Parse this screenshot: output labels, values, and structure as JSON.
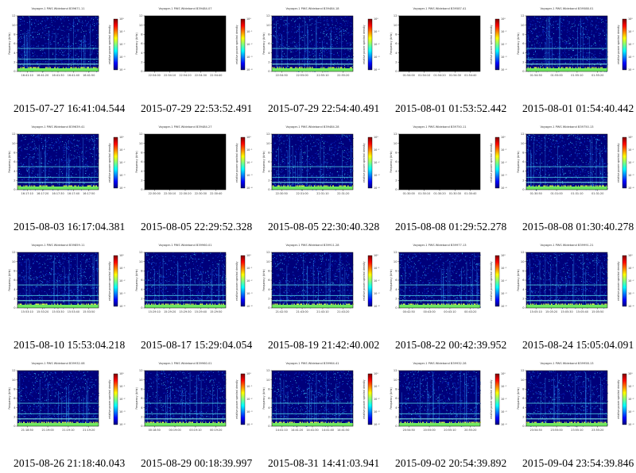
{
  "chart_data": {
    "type": "heatmap",
    "layout": {
      "rows": 4,
      "cols": 5
    },
    "panel_title_prefix": "Voyager-1 PWS Wideband",
    "ylabel": "Frequency (kHz)",
    "colorbar_label": "relative power spectral density",
    "y_ticks": [
      "0",
      "2",
      "4",
      "6",
      "8",
      "10",
      "12"
    ],
    "ylim": [
      0,
      12
    ],
    "colorbar_ticks": [
      "10⁻⁴",
      "10⁻³",
      "10⁻²",
      "10⁻¹",
      "10⁰"
    ],
    "colormap": [
      "#00007f",
      "#0000ff",
      "#007fff",
      "#00ffff",
      "#7fff7f",
      "#ffff00",
      "#ff7f00",
      "#ff0000",
      "#7f0000"
    ],
    "panels": [
      {
        "caption": "2015-07-27 16:41:04.544",
        "id": "B39671.11",
        "has_data": true,
        "x_ticks": [
          "16:41:10",
          "16:41:20",
          "16:41:30",
          "16:41:40",
          "16:41:50"
        ]
      },
      {
        "caption": "2015-07-29 22:53:52.491",
        "id": "B39484.07",
        "has_data": false,
        "x_ticks": [
          "22:54:00",
          "22:54:10",
          "22:54:20",
          "22:54:30",
          "22:54:40"
        ]
      },
      {
        "caption": "2015-07-29 22:54:40.491",
        "id": "B39484.18",
        "has_data": true,
        "x_ticks": [
          "22:54:50",
          "22:55:00",
          "22:55:10",
          "22:55:20"
        ]
      },
      {
        "caption": "2015-08-01 01:53:52.442",
        "id": "B39587.41",
        "has_data": false,
        "x_ticks": [
          "01:54:00",
          "01:54:10",
          "01:54:20",
          "01:54:30",
          "01:54:40"
        ]
      },
      {
        "caption": "2015-08-01 01:54:40.442",
        "id": "B39588.01",
        "has_data": true,
        "x_ticks": [
          "01:54:50",
          "01:55:00",
          "01:55:10",
          "01:55:20"
        ]
      },
      {
        "caption": "2015-08-03 16:17:04.381",
        "id": "B39639.41",
        "has_data": true,
        "x_ticks": [
          "16:17:10",
          "16:17:20",
          "16:17:30",
          "16:17:40",
          "16:17:50"
        ]
      },
      {
        "caption": "2015-08-05 22:29:52.328",
        "id": "B39484.27",
        "has_data": false,
        "x_ticks": [
          "22:30:00",
          "22:30:10",
          "22:30:20",
          "22:30:30",
          "22:30:40"
        ]
      },
      {
        "caption": "2015-08-05 22:30:40.328",
        "id": "B39484.28",
        "has_data": true,
        "x_ticks": [
          "22:30:50",
          "22:31:00",
          "22:31:10",
          "22:31:20"
        ]
      },
      {
        "caption": "2015-08-08 01:29:52.278",
        "id": "B39750.11",
        "has_data": false,
        "x_ticks": [
          "01:30:00",
          "01:30:10",
          "01:30:20",
          "01:30:30",
          "01:30:40"
        ]
      },
      {
        "caption": "2015-08-08 01:30:40.278",
        "id": "B39750.13",
        "has_data": true,
        "x_ticks": [
          "01:30:50",
          "01:31:00",
          "01:31:10",
          "01:31:20"
        ]
      },
      {
        "caption": "2015-08-10 15:53:04.218",
        "id": "B39859.11",
        "has_data": true,
        "x_ticks": [
          "15:53:10",
          "15:53:20",
          "15:53:30",
          "15:53:40",
          "15:53:50"
        ]
      },
      {
        "caption": "2015-08-17 15:29:04.054",
        "id": "B39960.01",
        "has_data": true,
        "x_ticks": [
          "15:29:10",
          "15:29:20",
          "15:29:30",
          "15:29:40",
          "15:29:50"
        ]
      },
      {
        "caption": "2015-08-19 21:42:40.002",
        "id": "B39911.28",
        "has_data": true,
        "x_ticks": [
          "21:42:50",
          "21:43:00",
          "21:43:10",
          "21:43:20"
        ]
      },
      {
        "caption": "2015-08-22 00:42:39.952",
        "id": "B39977.13",
        "has_data": true,
        "x_ticks": [
          "00:42:50",
          "00:43:00",
          "00:43:10",
          "00:43:20"
        ]
      },
      {
        "caption": "2015-08-24 15:05:04.091",
        "id": "B39991.21",
        "has_data": true,
        "x_ticks": [
          "15:05:10",
          "15:05:20",
          "15:05:30",
          "15:05:40",
          "15:05:50"
        ]
      },
      {
        "caption": "2015-08-26 21:18:40.043",
        "id": "B39932.08",
        "has_data": true,
        "x_ticks": [
          "21:18:50",
          "21:19:00",
          "21:19:10",
          "21:19:20"
        ]
      },
      {
        "caption": "2015-08-29 00:18:39.997",
        "id": "B39960.01",
        "has_data": true,
        "x_ticks": [
          "00:18:50",
          "00:19:00",
          "00:19:10",
          "00:19:20"
        ]
      },
      {
        "caption": "2015-08-31 14:41:03.941",
        "id": "B39964.41",
        "has_data": true,
        "x_ticks": [
          "14:41:10",
          "14:41:20",
          "14:41:30",
          "14:41:40",
          "14:41:50"
        ]
      },
      {
        "caption": "2015-09-02 20:54:39.892",
        "id": "B39932.28",
        "has_data": true,
        "x_ticks": [
          "20:54:50",
          "20:55:00",
          "20:55:10",
          "20:55:20"
        ]
      },
      {
        "caption": "2015-09-04 23:54:39.846",
        "id": "B39958.13",
        "has_data": true,
        "x_ticks": [
          "23:54:50",
          "23:55:00",
          "23:55:10",
          "23:55:20"
        ]
      }
    ]
  }
}
